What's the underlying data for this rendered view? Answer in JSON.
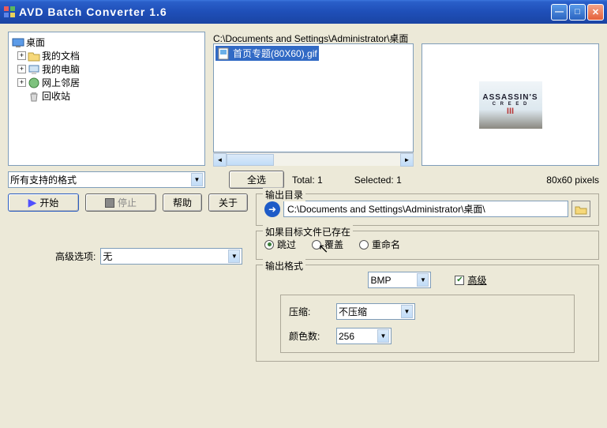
{
  "window": {
    "title": "AVD Batch Converter 1.6"
  },
  "tree": {
    "root": "桌面",
    "items": [
      "我的文档",
      "我的电脑",
      "网上邻居",
      "回收站"
    ]
  },
  "filelist": {
    "path": "C:\\Documents and Settings\\Administrator\\桌面",
    "items": [
      "首页专题(80X60).gif"
    ]
  },
  "preview": {
    "t1": "ASSASSIN'S",
    "t2": "C R E E D",
    "t3": "III"
  },
  "format_filter": {
    "selected": "所有支持的格式"
  },
  "select_all_btn": "全选",
  "stats": {
    "total_label": "Total:",
    "total_val": "1",
    "selected_label": "Selected:",
    "selected_val": "1",
    "pixels": "80x60 pixels"
  },
  "buttons": {
    "start": "开始",
    "stop": "停止",
    "help": "帮助",
    "about": "关于"
  },
  "adv_option": {
    "label": "高级选项:",
    "value": "无"
  },
  "outdir": {
    "legend": "输出目录",
    "path": "C:\\Documents and Settings\\Administrator\\桌面\\"
  },
  "overwrite": {
    "legend": "如果目标文件已存在",
    "skip": "跳过",
    "overwrite": "覆盖",
    "rename": "重命名"
  },
  "outfmt": {
    "legend": "输出格式",
    "format": "BMP",
    "adv_chk": "高级",
    "compress_label": "压缩:",
    "compress_val": "不压缩",
    "colors_label": "颜色数:",
    "colors_val": "256"
  }
}
